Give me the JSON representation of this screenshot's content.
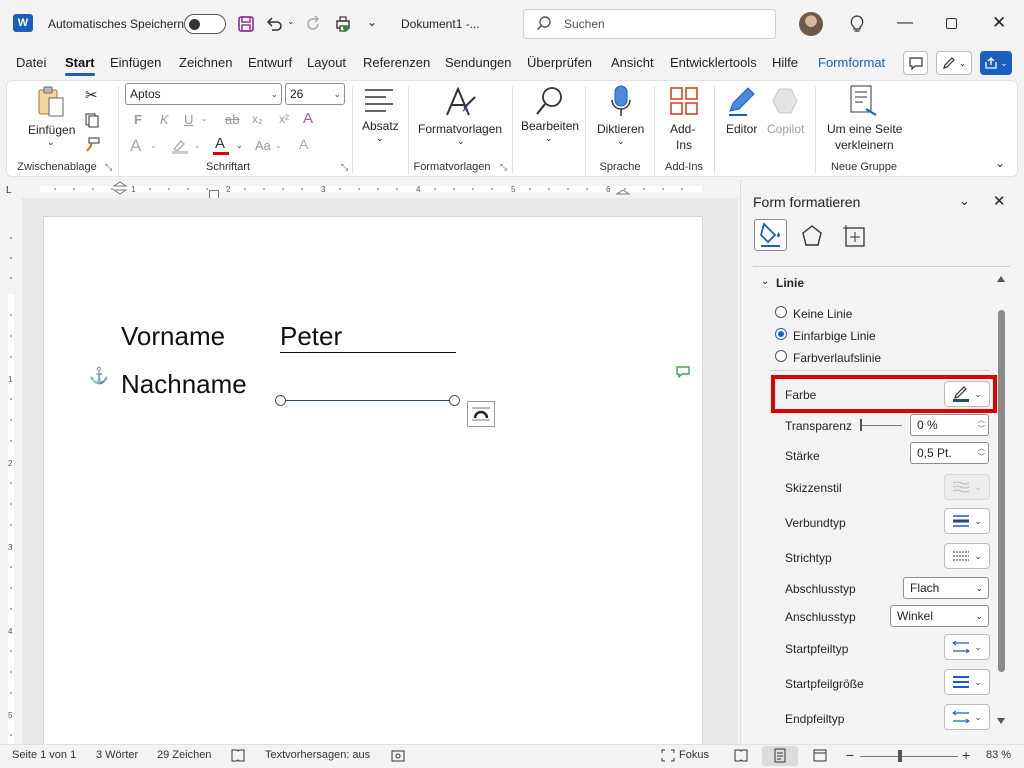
{
  "titlebar": {
    "autosave_label": "Automatisches Speichern",
    "doc_title": "Dokument1  -...",
    "search_placeholder": "Suchen"
  },
  "tabs": [
    "Datei",
    "Start",
    "Einfügen",
    "Zeichnen",
    "Entwurf",
    "Layout",
    "Referenzen",
    "Sendungen",
    "Überprüfen",
    "Ansicht",
    "Entwicklertools",
    "Hilfe",
    "Formformat"
  ],
  "active_tab": "Start",
  "ribbon": {
    "clipboard": {
      "paste": "Einfügen",
      "label": "Zwischenablage"
    },
    "font": {
      "name": "Aptos",
      "size": "26",
      "bold": "F",
      "italic": "K",
      "underline": "U",
      "strike": "ab",
      "sub": "x₂",
      "sup": "x²",
      "case": "Aa",
      "label": "Schriftart"
    },
    "paragraph": {
      "label": "Absatz"
    },
    "styles": {
      "button": "Formatvorlagen",
      "label": "Formatvorlagen"
    },
    "edit": {
      "button": "Bearbeiten"
    },
    "voice": {
      "button": "Diktieren",
      "label": "Sprache"
    },
    "addins": {
      "button1": "Add-",
      "button2": "Ins",
      "label": "Add-Ins"
    },
    "editor": {
      "button": "Editor"
    },
    "copilot": {
      "button": "Copilot"
    },
    "shrink": {
      "line1": "Um eine Seite",
      "line2": "verkleinern",
      "label": "Neue Gruppe"
    }
  },
  "document": {
    "first_label": "Vorname",
    "first_value": "Peter",
    "last_label": "Nachname"
  },
  "pane": {
    "title": "Form formatieren",
    "section": "Linie",
    "radio_none": "Keine Linie",
    "radio_solid": "Einfarbige Linie",
    "radio_gradient": "Farbverlaufslinie",
    "farbe": "Farbe",
    "transparenz": "Transparenz",
    "transparenz_value": "0 %",
    "staerke": "Stärke",
    "staerke_value": "0,5 Pt.",
    "skizzenstil": "Skizzenstil",
    "verbundtyp": "Verbundtyp",
    "strichtyp": "Strichtyp",
    "abschlusstyp": "Abschlusstyp",
    "abschlusstyp_value": "Flach",
    "anschlusstyp": "Anschlusstyp",
    "anschlusstyp_value": "Winkel",
    "startpfeiltyp": "Startpfeiltyp",
    "startpfeilgroesse": "Startpfeilgröße",
    "endpfeiltyp": "Endpfeiltyp"
  },
  "status": {
    "page": "Seite 1 von 1",
    "words": "3 Wörter",
    "chars": "29 Zeichen",
    "prediction": "Textvorhersagen: aus",
    "focus": "Fokus",
    "zoom": "83 %"
  },
  "colors": {
    "accent": "#1b5ebe",
    "highlight": "#e00000",
    "word": "#1b5ebe"
  }
}
